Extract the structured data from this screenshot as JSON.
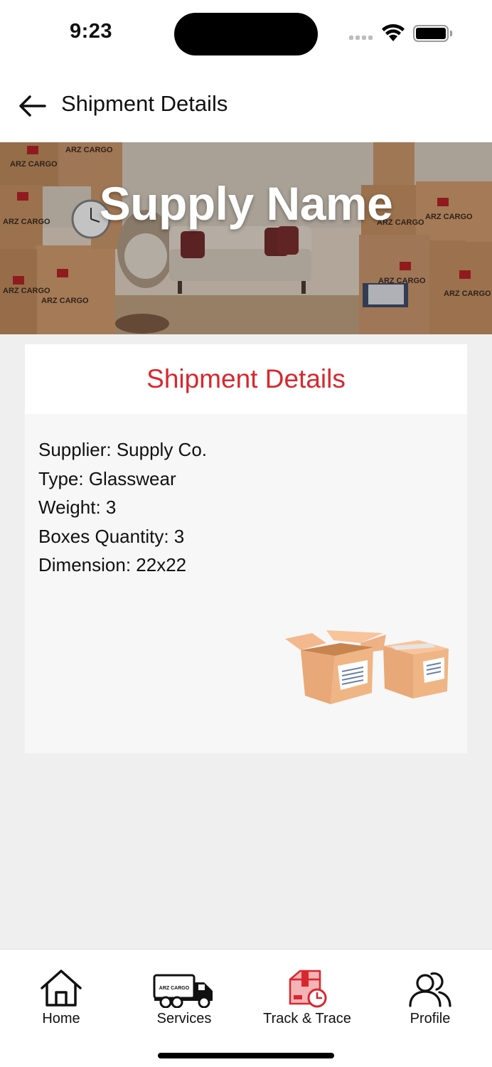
{
  "status_bar": {
    "time": "9:23"
  },
  "header": {
    "title": "Shipment Details"
  },
  "hero": {
    "title": "Supply Name",
    "box_brand": "ARZ CARGO"
  },
  "card": {
    "title": "Shipment Details",
    "details": [
      "Supplier: Supply Co.",
      "Type: Glasswear",
      "Weight: 3",
      "Boxes Quantity: 3",
      "Dimension: 22x22"
    ]
  },
  "tabs": [
    {
      "label": "Home",
      "icon": "home-icon"
    },
    {
      "label": "Services",
      "icon": "truck-icon"
    },
    {
      "label": "Track & Trace",
      "icon": "track-box-icon",
      "active": true
    },
    {
      "label": "Profile",
      "icon": "users-icon"
    }
  ],
  "colors": {
    "accent": "#d9272e",
    "background": "#efefef",
    "card": "#f7f7f7"
  }
}
